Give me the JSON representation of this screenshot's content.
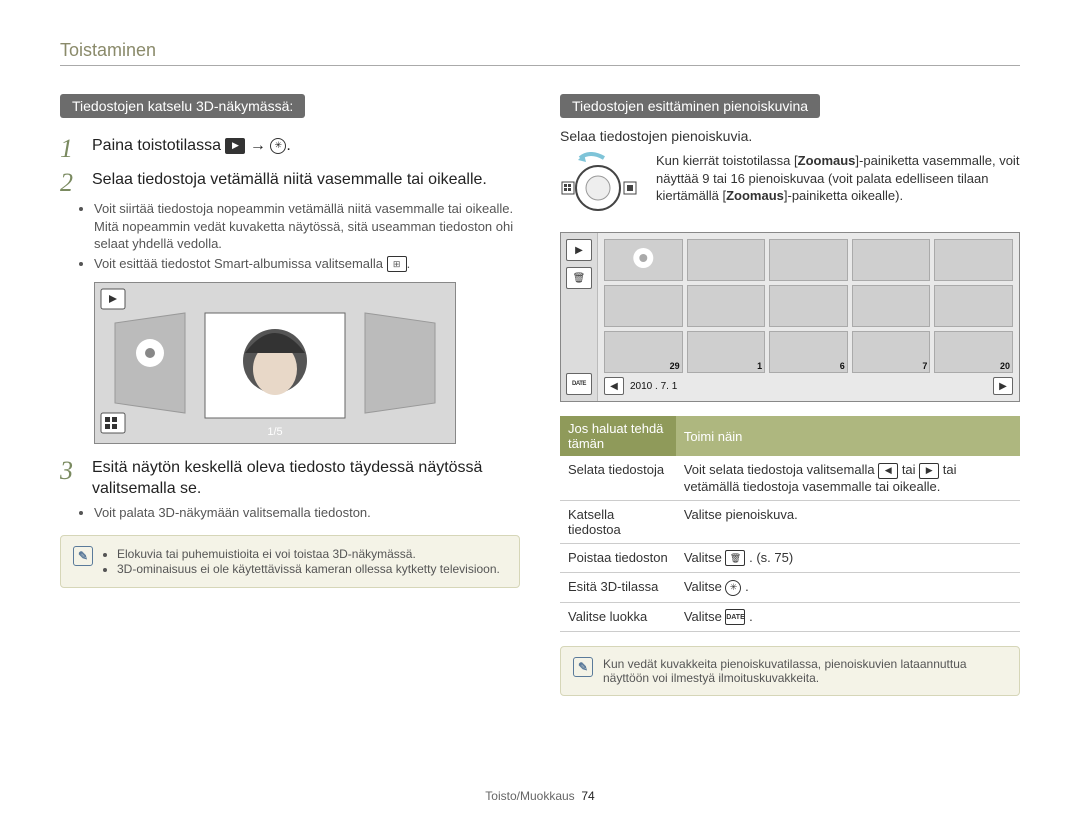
{
  "pageTitle": "Toistaminen",
  "left": {
    "pill": "Tiedostojen katselu 3D-näkymässä:",
    "step1_pre": "Paina toistotilassa",
    "step1_post": " → ",
    "step2": "Selaa tiedostoja vetämällä niitä vasemmalle tai oikealle.",
    "bullets2": [
      "Voit siirtää tiedostoja nopeammin vetämällä niitä vasemmalle tai oikealle. Mitä nopeammin vedät kuvaketta näytössä, sitä useamman tiedoston ohi selaat yhdellä vedolla.",
      "Voit esittää tiedostot Smart-albumissa valitsemalla "
    ],
    "counter": "1/5",
    "step3": "Esitä näytön keskellä oleva tiedosto täydessä näytössä valitsemalla se.",
    "bullet3": "Voit palata 3D-näkymään valitsemalla tiedoston.",
    "note": [
      "Elokuvia tai puhemuistioita ei voi toistaa 3D-näkymässä.",
      "3D-ominaisuus ei ole käytettävissä kameran ollessa kytketty televisioon."
    ]
  },
  "right": {
    "pill": "Tiedostojen esittäminen pienoiskuvina",
    "sub": "Selaa tiedostojen pienoiskuvia.",
    "zoom_pre": "Kun kierrät toistotilassa [",
    "zoom_word1": "Zoomaus",
    "zoom_mid1": "]-painiketta vasemmalle, voit näyttää 9 tai 16 pienoiskuvaa (voit palata edelliseen tilaan kiertämällä [",
    "zoom_word2": "Zoomaus",
    "zoom_mid2": "]-painiketta oikealle).",
    "thumb": {
      "cells": [
        "",
        "",
        "",
        "",
        "",
        "",
        "",
        "",
        "",
        "",
        "29",
        "1",
        "6",
        "7",
        "20"
      ],
      "date": "2010 . 7. 1"
    },
    "table": {
      "head": [
        "Jos haluat tehdä tämän",
        "Toimi näin"
      ],
      "rows": [
        {
          "a": "Selata tiedostoja",
          "b_pre": "Voit selata tiedostoja valitsemalla ",
          "b_post": " tai vetämällä tiedostoja vasemmalle tai oikealle."
        },
        {
          "a": "Katsella tiedostoa",
          "b": "Valitse pienoiskuva."
        },
        {
          "a": "Poistaa tiedoston",
          "b_pre": "Valitse ",
          "b_post": ". (s. 75)"
        },
        {
          "a": "Esitä 3D-tilassa",
          "b_pre": "Valitse ",
          "b_post": "."
        },
        {
          "a": "Valitse luokka",
          "b_pre": "Valitse ",
          "b_post": "."
        }
      ]
    },
    "note": "Kun vedät kuvakkeita pienoiskuvatilassa, pienoiskuvien lataannuttua näyttöön voi ilmestyä ilmoituskuvakkeita."
  },
  "footer": {
    "section": "Toisto/Muokkaus",
    "page": "74"
  }
}
